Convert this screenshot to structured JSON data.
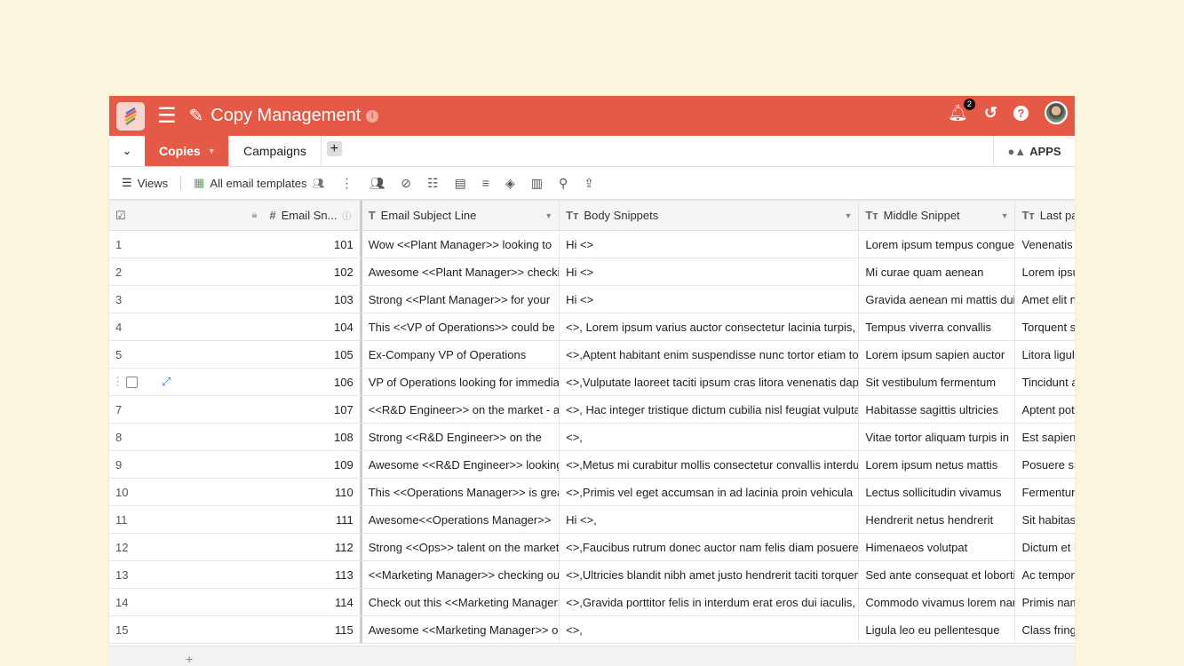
{
  "header": {
    "title": "Copy Management",
    "notification_count": "2",
    "accent": "#e55a47"
  },
  "tabs": {
    "items": [
      {
        "label": "Copies",
        "active": true
      },
      {
        "label": "Campaigns",
        "active": false
      }
    ],
    "apps_label": "APPS"
  },
  "toolbar": {
    "views_label": "Views",
    "view_name": "All email templates"
  },
  "columns": [
    "Email Sn...",
    "Email Subject Line",
    "Body Snippets",
    "Middle Snippet",
    "Last pa"
  ],
  "rows": [
    [
      "1",
      "101",
      "Wow <<Plant Manager>> looking to",
      "Hi <>",
      "Lorem ipsum tempus congue",
      "Venenatis p"
    ],
    [
      "2",
      "102",
      "Awesome <<Plant Manager>> checking",
      "Hi <>",
      "Mi curae quam aenean",
      "Lorem ipsu"
    ],
    [
      "3",
      "103",
      "Strong <<Plant Manager>> for your",
      "Hi <>",
      "Gravida aenean mi mattis duis",
      "Amet elit ne"
    ],
    [
      "4",
      "104",
      "This <<VP of Operations>> could be a",
      "<>, Lorem ipsum varius auctor consectetur lacinia turpis,",
      "Tempus viverra convallis",
      "Torquent si"
    ],
    [
      "5",
      "105",
      "Ex-Company VP of Operations",
      "<>,Aptent habitant enim suspendisse nunc tortor etiam tortor",
      "Lorem ipsum sapien auctor",
      "Litora ligula"
    ],
    [
      "",
      "106",
      "VP of Operations looking for immediate",
      "<>,Vulputate laoreet taciti ipsum cras litora venenatis dapibus",
      "Sit vestibulum fermentum",
      "Tincidunt a"
    ],
    [
      "7",
      "107",
      "<<R&D Engineer>> on the market - are",
      "<>, Hac integer tristique dictum cubilia nisl feugiat vulputate",
      "Habitasse sagittis ultricies",
      "Aptent pote"
    ],
    [
      "8",
      "108",
      "Strong <<R&D Engineer>> on the",
      "<>,",
      "Vitae tortor aliquam turpis in",
      "Est sapien s"
    ],
    [
      "9",
      "109",
      "Awesome <<R&D Engineer>> looking to",
      "<>,Metus mi curabitur mollis consectetur convallis interdum",
      "Lorem ipsum netus mattis",
      "Posuere su"
    ],
    [
      "10",
      "110",
      "This <<Operations Manager>> is great",
      "<>,Primis vel eget accumsan in ad lacinia proin vehicula",
      "Lectus sollicitudin vivamus",
      "Fermentum"
    ],
    [
      "11",
      "111",
      "Awesome<<Operations Manager>>",
      "Hi <>,",
      "Hendrerit netus hendrerit",
      "Sit habitass"
    ],
    [
      "12",
      "112",
      "Strong <<Ops>> talent on the market",
      "<>,Faucibus rutrum donec auctor nam felis diam posuere erat",
      "Himenaeos volutpat",
      "Dictum et la"
    ],
    [
      "13",
      "113",
      "<<Marketing Manager>> checking out",
      "<>,Ultricies blandit nibh amet justo hendrerit taciti torquent",
      "Sed ante consequat et lobortis",
      "Ac tempor l"
    ],
    [
      "14",
      "114",
      "Check out this <<Marketing Manager>>",
      "<>,Gravida porttitor felis in interdum erat eros dui iaculis,",
      "Commodo vivamus lorem nam",
      "Primis nam"
    ],
    [
      "15",
      "115",
      "Awesome <<Marketing Manager>> on",
      "<>,",
      "Ligula leo eu pellentesque",
      "Class fringi"
    ]
  ]
}
